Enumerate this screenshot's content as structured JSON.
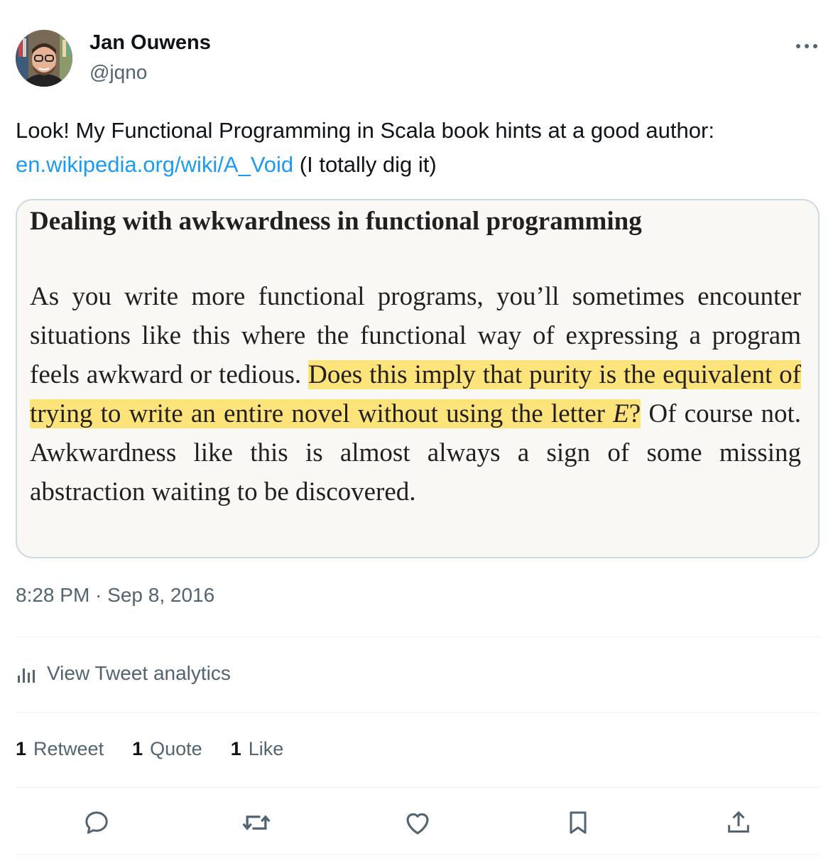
{
  "author": {
    "name": "Jan Ouwens",
    "handle": "@jqno"
  },
  "tweet": {
    "text_before": "Look! My Functional Programming in Scala book hints at a good author:",
    "link": "en.wikipedia.org/wiki/A_Void",
    "text_after": " (I totally dig it)"
  },
  "book_page": {
    "title": "Dealing with awkwardness in functional programming",
    "para_start": "As you write more functional programs, you’ll sometimes encounter situations like this where the functional way of expressing a program feels awkward or tedious. ",
    "highlight_part1": "Does this imply that purity is the equivalent of trying to write an entire novel without using the letter ",
    "highlight_italic": "E",
    "highlight_end": "?",
    "para_end": " Of course not. Awkwardness like this is almost always a sign of some missing abstraction waiting to be discovered."
  },
  "timestamp": "8:28 PM · Sep 8, 2016",
  "analytics": {
    "label": "View Tweet analytics",
    "icon": "bar-chart-icon"
  },
  "stats": [
    {
      "count": "1",
      "label": "Retweet"
    },
    {
      "count": "1",
      "label": "Quote"
    },
    {
      "count": "1",
      "label": "Like"
    }
  ],
  "actions": [
    "reply-icon",
    "retweet-icon",
    "like-icon",
    "bookmark-icon",
    "share-icon"
  ],
  "colors": {
    "link": "#1d9bf0",
    "secondary_text": "#536471",
    "highlight": "#fde47a",
    "border": "#cfd9de"
  }
}
